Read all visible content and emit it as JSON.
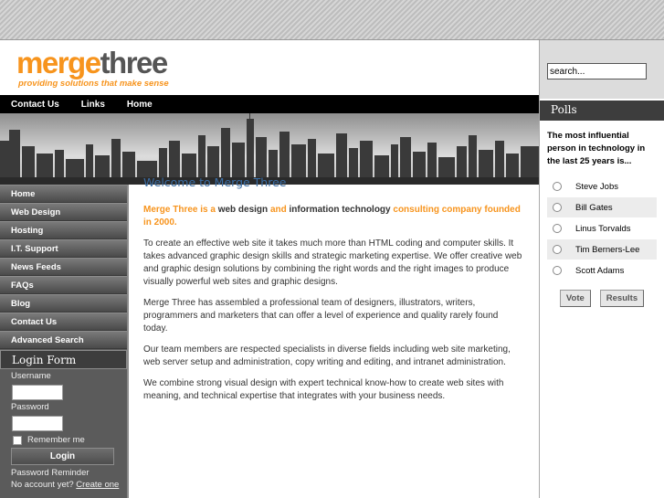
{
  "header": {
    "logo_part1": "merge",
    "logo_part2": "three",
    "tagline": "providing solutions that make sense"
  },
  "topnav": {
    "items": [
      "Contact Us",
      "Links",
      "Home"
    ]
  },
  "sidebar": {
    "items": [
      "Home",
      "Web Design",
      "Hosting",
      "I.T. Support",
      "News Feeds",
      "FAQs",
      "Blog",
      "Contact Us",
      "Advanced Search"
    ]
  },
  "login": {
    "title": "Login Form",
    "username_label": "Username",
    "password_label": "Password",
    "remember_label": "Remember me",
    "button_label": "Login",
    "reminder_link": "Password Reminder",
    "no_account_text": "No account yet?",
    "create_link": "Create one"
  },
  "content": {
    "title": "Welcome to Merge Three",
    "intro": {
      "p1": "Merge Three is a",
      "p2": " web design ",
      "p3": "and",
      "p4": " information technology ",
      "p5": "consulting company founded in 2000."
    },
    "paragraphs": [
      "To create an effective web site it takes much more than HTML coding and computer skills. It takes advanced graphic design skills and strategic marketing expertise. We offer creative web and graphic design solutions by combining the right words and the right images to produce visually powerful web sites and graphic designs.",
      "Merge Three has assembled a professional team of designers, illustrators, writers, programmers and marketers that can offer a level of experience and quality rarely found today.",
      "Our team members are respected specialists in diverse fields including web site marketing, web server setup and administration, copy writing and editing, and intranet administration.",
      "We combine strong visual design with expert technical know-how to create web sites with meaning, and technical expertise that integrates with your business needs."
    ]
  },
  "search": {
    "value": "search..."
  },
  "polls": {
    "title": "Polls",
    "question": "The most influential person in technology in the last 25 years is...",
    "options": [
      "Steve Jobs",
      "Bill Gates",
      "Linus Torvalds",
      "Tim Berners-Lee",
      "Scott Adams"
    ],
    "vote_label": "Vote",
    "results_label": "Results"
  },
  "colors": {
    "brand_orange": "#f7941d",
    "title_blue": "#3b6ea5",
    "nav_black": "#000000",
    "sidebar_gray": "#5b5b5b"
  }
}
